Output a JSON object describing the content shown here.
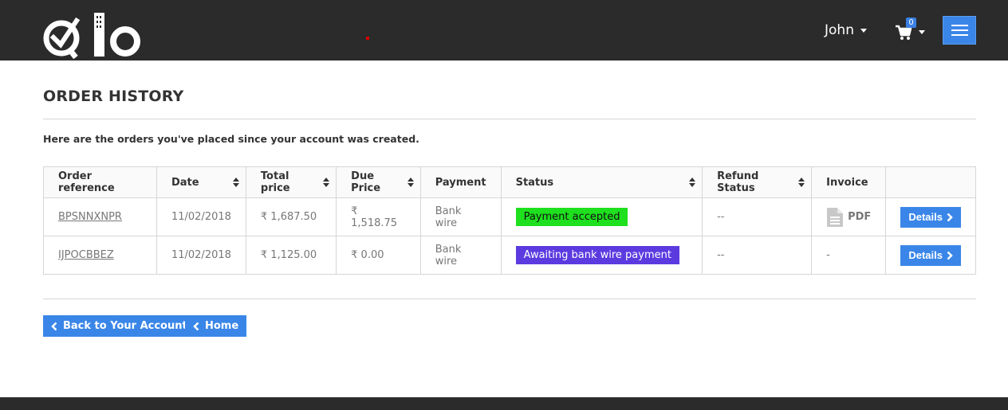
{
  "header": {
    "brand": "Qlo",
    "user_name": "John",
    "cart_count": "0",
    "menu_icon": "hamburger-icon",
    "colors": {
      "bar": "#2b2b2b",
      "accent": "#3a86e8"
    }
  },
  "page": {
    "title": "ORDER HISTORY",
    "intro": "Here are the orders you've placed since your account was created."
  },
  "table": {
    "headers": [
      "Order reference",
      "Date",
      "Total price",
      "Due Price",
      "Payment",
      "Status",
      "Refund Status",
      "Invoice",
      ""
    ],
    "rows": [
      {
        "reference": "BPSNNXNPR",
        "date": "11/02/2018",
        "total": "₹ 1,687.50",
        "due": "₹ 1,518.75",
        "payment": "Bank wire",
        "status": "Payment accepted",
        "status_color": "#1ee01e",
        "refund": "--",
        "invoice": "PDF",
        "details": "Details"
      },
      {
        "reference": "IJPOCBBEZ",
        "date": "11/02/2018",
        "total": "₹ 1,125.00",
        "due": "₹ 0.00",
        "payment": "Bank wire",
        "status": "Awaiting bank wire payment",
        "status_color": "#5b3be0",
        "refund": "--",
        "invoice": "-",
        "details": "Details"
      }
    ]
  },
  "footer_nav": {
    "back_label": "Back to Your Account",
    "home_label": "Home"
  }
}
